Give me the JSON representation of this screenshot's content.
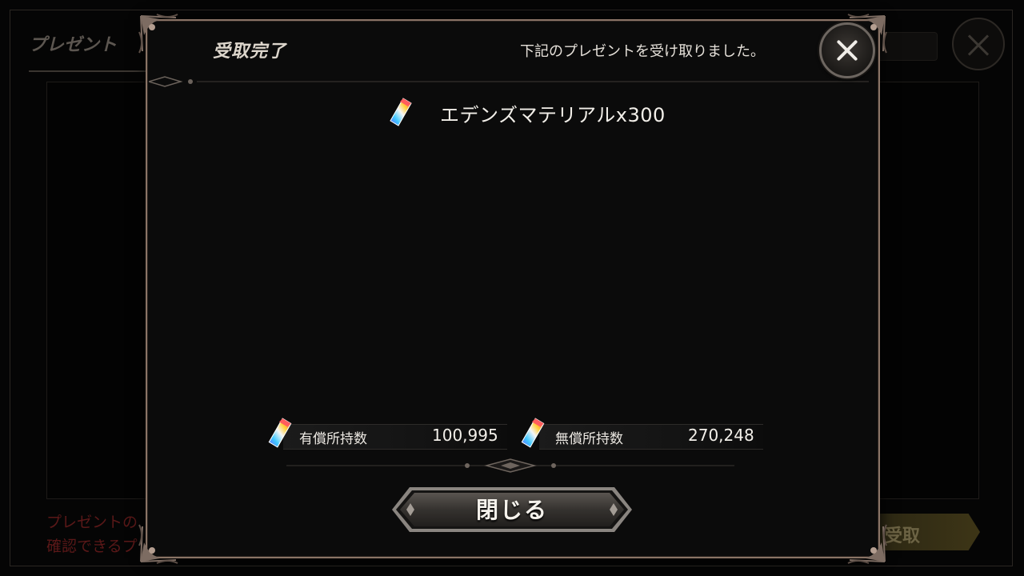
{
  "background": {
    "title": "プレゼント",
    "receive_button_label": "受取",
    "note_line1": "プレゼントの",
    "note_line2": "確認できるプ"
  },
  "modal": {
    "title": "受取完了",
    "message": "下記のプレゼントを受け取りました。",
    "reward": {
      "icon": "rainbow-crystal-icon",
      "label": "エデンズマテリアルx300"
    },
    "paid_currency": {
      "label": "有償所持数",
      "value": "100,995"
    },
    "free_currency": {
      "label": "無償所持数",
      "value": "270,248"
    },
    "close_button_label": "閉じる"
  },
  "colors": {
    "frame_border": "#8a7466",
    "panel_bg": "#0b0b0b",
    "text": "#f2efe9",
    "bg_note_red": "#5a1818"
  }
}
